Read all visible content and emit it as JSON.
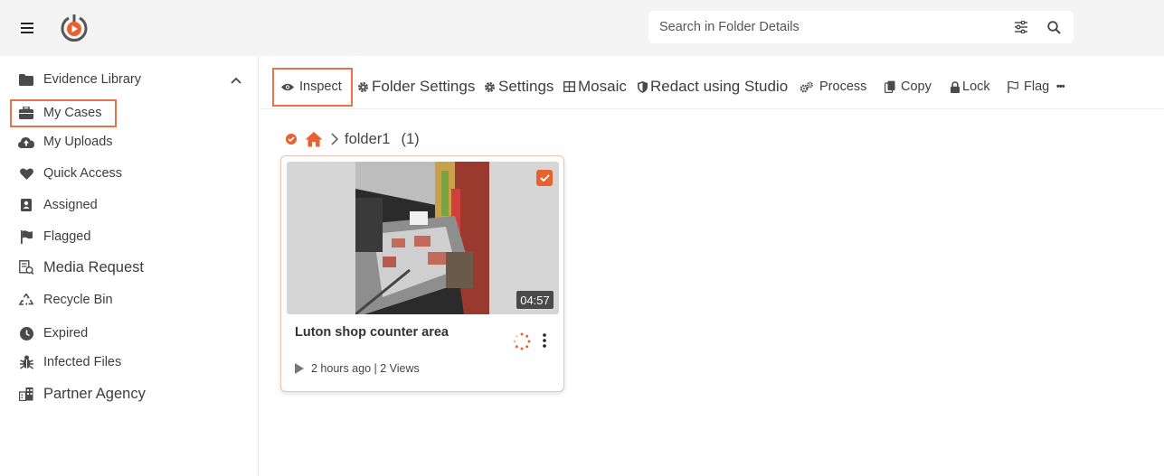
{
  "header": {
    "search_placeholder": "Search in Folder Details",
    "icons": [
      "hamburger-icon",
      "app-logo",
      "filter-sliders-icon",
      "search-icon"
    ]
  },
  "sidebar": {
    "items": [
      {
        "label": "Evidence Library",
        "icon": "folder-icon"
      },
      {
        "label": "My Cases",
        "icon": "briefcase-icon"
      },
      {
        "label": "My Uploads",
        "icon": "cloud-upload-icon"
      },
      {
        "label": "Quick Access",
        "icon": "heart-icon"
      },
      {
        "label": "Assigned",
        "icon": "contact-card-icon"
      },
      {
        "label": "Flagged",
        "icon": "flag-icon"
      },
      {
        "label": "Media Request",
        "icon": "request-document-icon"
      },
      {
        "label": "Recycle Bin",
        "icon": "recycle-icon"
      },
      {
        "label": "Expired",
        "icon": "clock-icon"
      },
      {
        "label": "Infected Files",
        "icon": "bug-icon"
      },
      {
        "label": "Partner Agency",
        "icon": "partner-agency-icon"
      }
    ]
  },
  "toolbar": {
    "inspect": "Inspect",
    "folder_settings": "Folder Settings",
    "settings": "Settings",
    "mosaic": "Mosaic",
    "redact": "Redact using Studio",
    "process": "Process",
    "copy": "Copy",
    "lock": "Lock",
    "flag": "Flag",
    "more": "•••"
  },
  "breadcrumb": {
    "folder": "folder1",
    "count": "(1)"
  },
  "card": {
    "title": "Luton shop counter area",
    "duration": "04:57",
    "meta": "2 hours ago | 2 Views"
  },
  "colors": {
    "accent": "#e8612e",
    "highlight_border": "#e8734a"
  }
}
